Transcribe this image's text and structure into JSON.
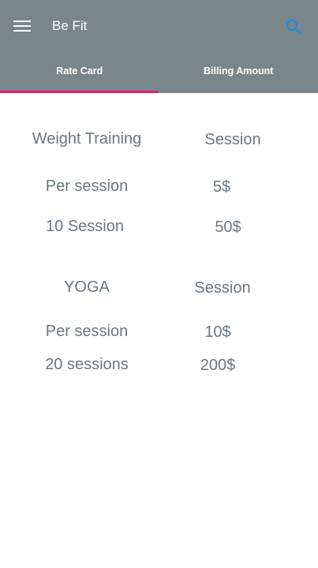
{
  "app": {
    "title": "Be Fit",
    "menu_icon": "hamburger-menu-icon",
    "search_icon": "search-icon",
    "colors": {
      "appbar": "#78868b",
      "tab_indicator": "#e91e63",
      "search_icon": "#1e90d6",
      "body_text": "#6b7780"
    }
  },
  "tabs": [
    {
      "label": "Rate Card",
      "selected": true
    },
    {
      "label": "Billing Amount",
      "selected": false
    }
  ],
  "rate_card": {
    "weight_training": {
      "header": "Weight Training",
      "column": "Session",
      "rows": [
        {
          "label": "Per session",
          "price": "5$"
        },
        {
          "label": "10 Session",
          "price": "50$"
        }
      ]
    },
    "yoga": {
      "header": "YOGA",
      "column": "Session",
      "rows": [
        {
          "label": "Per session",
          "price": "10$"
        },
        {
          "label": "20 sessions",
          "price": "200$"
        }
      ]
    }
  }
}
